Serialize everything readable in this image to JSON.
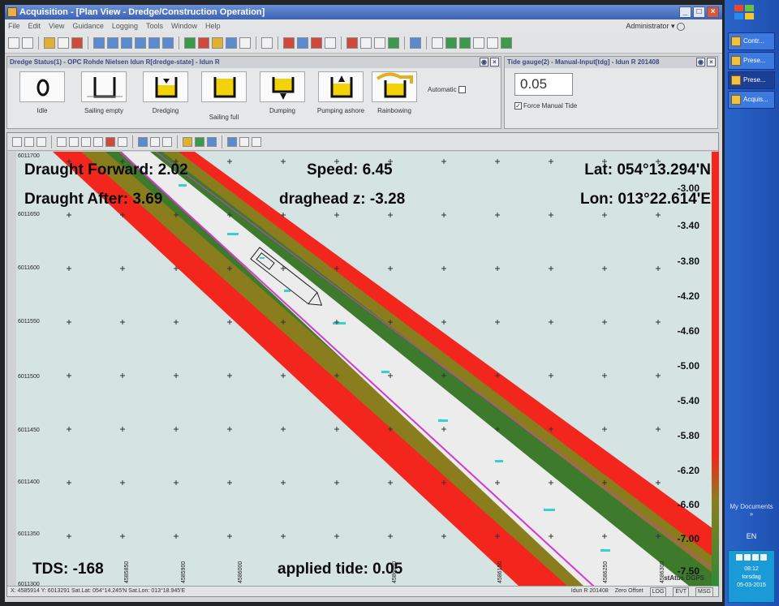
{
  "window": {
    "title": "Acquisition - [Plan View - Dredge/Construction Operation]"
  },
  "menu": [
    "File",
    "Edit",
    "View",
    "Guidance",
    "Logging",
    "Tools",
    "Window",
    "Help"
  ],
  "user": "Administrator",
  "dredge_panel": {
    "title": "Dredge Status(1) - OPC Rohde Nielsen Idun R[dredge-state] - Idun R",
    "states": [
      {
        "label": "Idle"
      },
      {
        "label": "Sailing empty"
      },
      {
        "label": "Dredging"
      },
      {
        "label": "Sailing full"
      },
      {
        "label": "Dumping"
      },
      {
        "label": "Pumping ashore"
      },
      {
        "label": "Rainbowing"
      }
    ],
    "automatic_label": "Automatic"
  },
  "tide_panel": {
    "title": "Tide gauge(2) - Manual-Input[tdg] - Idun R 201408",
    "value": "0.05",
    "force_label": "Force Manual Tide",
    "force_checked": true
  },
  "map": {
    "y_labels": [
      "6011700",
      "6011650",
      "6011600",
      "6011550",
      "6011500",
      "6011450",
      "6011400",
      "6011350",
      "6011300"
    ],
    "x_labels": [
      "4585850",
      "4585900",
      "4586000",
      "4586050",
      "4586150",
      "4586250",
      "4586300"
    ],
    "overlays": {
      "draught_forward": "Draught Forward: 2.02",
      "draught_after": "Draught After: 3.69",
      "speed": "Speed: 6.45",
      "draghead_z": "draghead z: -3.28",
      "lat": "Lat: 054°13.294'N",
      "lon": "Lon: 013°22.614'E",
      "tds": "TDS: -168",
      "applied_tide": "applied tide: 0.05"
    },
    "depth_scale": [
      "-3.00",
      "-3.40",
      "-3.80",
      "-4.20",
      "-4.60",
      "-5.00",
      "-5.40",
      "-5.80",
      "-6.20",
      "-6.60",
      "-7.00",
      "-7.50"
    ],
    "watermark": "stAtus DGPS",
    "colors": {
      "outer": "#f2261c",
      "bank": "#8a7d1e",
      "edge": "#3d7a2c",
      "channel": "#ececec",
      "background": "#d6e3e3",
      "centerline": "#d23ad0"
    }
  },
  "statusbar": {
    "coords": "X: 4585914   Y: 6013291   Sat.Lat: 054°14.245'N   Sat.Lon: 013°18.945'E",
    "vessel": "Idun R 201408",
    "offset": "Zero Offset",
    "flags": [
      "LOG",
      "EVT",
      "MSG"
    ]
  },
  "taskbar": {
    "items": [
      "Contr...",
      "Prese...",
      "Prese...",
      "Acquis..."
    ],
    "documents_label": "My Documents",
    "language": "EN",
    "time": "08:12",
    "day": "torsdag",
    "date": "05-03-2015"
  }
}
